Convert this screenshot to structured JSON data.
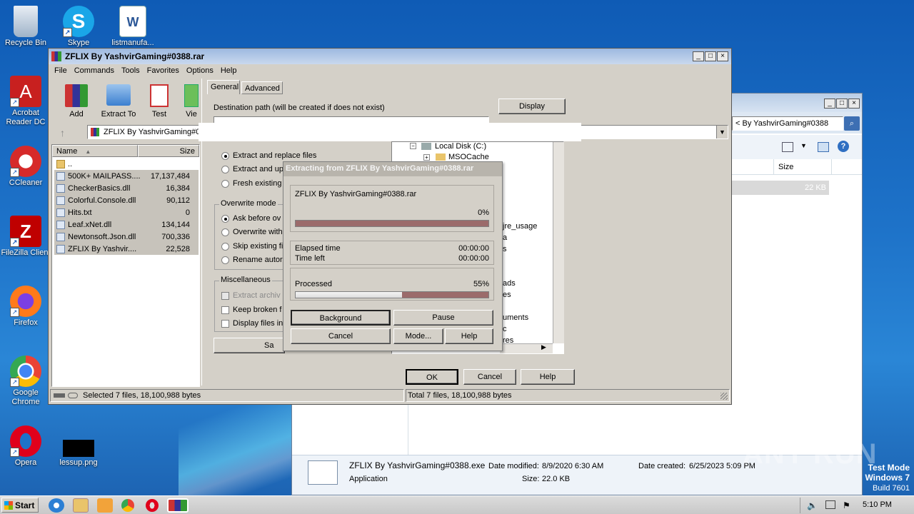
{
  "desktop": {
    "icons": [
      {
        "label": "Recycle Bin",
        "icon": "recycle-bin-icon"
      },
      {
        "label": "Skype",
        "icon": "skype-icon"
      },
      {
        "label": "listmanufa...",
        "icon": "word-document-icon"
      },
      {
        "label": "Acrobat Reader DC",
        "icon": "acrobat-icon"
      },
      {
        "label": "CCleaner",
        "icon": "ccleaner-icon"
      },
      {
        "label": "FileZilla Client",
        "icon": "filezilla-icon"
      },
      {
        "label": "Firefox",
        "icon": "firefox-icon"
      },
      {
        "label": "Google Chrome",
        "icon": "chrome-icon"
      },
      {
        "label": "Opera",
        "icon": "opera-icon"
      },
      {
        "label": "lessup.png",
        "icon": "image-file-icon"
      }
    ]
  },
  "winrar": {
    "title": "ZFLIX By YashvirGaming#0388.rar",
    "menu": [
      "File",
      "Commands",
      "Tools",
      "Favorites",
      "Options",
      "Help"
    ],
    "toolbar": [
      "Add",
      "Extract To",
      "Test",
      "Vie"
    ],
    "address": "ZFLIX By YashvirGaming#03",
    "columns": {
      "name": "Name",
      "size": "Size"
    },
    "files": [
      {
        "name": "..",
        "size": ""
      },
      {
        "name": "500K+ MAILPASS....",
        "size": "17,137,484"
      },
      {
        "name": "CheckerBasics.dll",
        "size": "16,384"
      },
      {
        "name": "Colorful.Console.dll",
        "size": "90,112"
      },
      {
        "name": "Hits.txt",
        "size": "0"
      },
      {
        "name": "Leaf.xNet.dll",
        "size": "134,144"
      },
      {
        "name": "Newtonsoft.Json.dll",
        "size": "700,336"
      },
      {
        "name": "ZFLIX By Yashvir....",
        "size": "22,528"
      }
    ],
    "status_left": "Selected 7 files, 18,100,988 bytes",
    "status_right": "Total 7 files, 18,100,988 bytes"
  },
  "extract_dialog": {
    "tabs": [
      "General",
      "Advanced"
    ],
    "dest_label": "Destination path (will be created if does not exist)",
    "display_button": "Display",
    "update_options": [
      "Extract and replace files",
      "Extract and up",
      "Fresh existing"
    ],
    "overwrite_title": "Overwrite mode",
    "overwrite_options": [
      "Ask before ov",
      "Overwrite with",
      "Skip existing fi",
      "Rename autor"
    ],
    "misc_title": "Miscellaneous",
    "misc_options": [
      "Extract archiv",
      "Keep broken f",
      "Display files in"
    ],
    "save_button": "Sa",
    "tree": [
      "Local Disk (C:)",
      "MSOCache",
      "jre_usage",
      "a",
      "s",
      "ads",
      "es",
      "uments",
      "c",
      "res"
    ],
    "ok": "OK",
    "cancel": "Cancel",
    "help": "Help"
  },
  "progress_dialog": {
    "title": "Extracting from ZFLIX By YashvirGaming#0388.rar",
    "file": "ZFLIX By YashvirGaming#0388.rar",
    "file_percent": "0%",
    "file_progress": 0,
    "elapsed_label": "Elapsed time",
    "elapsed": "00:00:00",
    "left_label": "Time left",
    "left": "00:00:00",
    "processed_label": "Processed",
    "processed_percent": "55%",
    "processed_progress": 55,
    "buttons": {
      "background": "Background",
      "pause": "Pause",
      "cancel": "Cancel",
      "mode": "Mode...",
      "help": "Help"
    }
  },
  "explorer": {
    "search_text": "< By YashvirGaming#0388",
    "size_col": "Size",
    "size_value": "22 KB",
    "details": {
      "name": "ZFLIX By YashvirGaming#0388.exe",
      "type": "Application",
      "modified_label": "Date modified:",
      "modified": "8/9/2020 6:30 AM",
      "size_label": "Size:",
      "size": "22.0 KB",
      "created_label": "Date created:",
      "created": "6/25/2023 5:09 PM"
    }
  },
  "watermark": {
    "brand": "ANY RUN",
    "line1": "Test Mode",
    "line2": "Windows 7",
    "line3": "Build 7601"
  },
  "taskbar": {
    "start": "Start",
    "clock": "5:10 PM"
  }
}
